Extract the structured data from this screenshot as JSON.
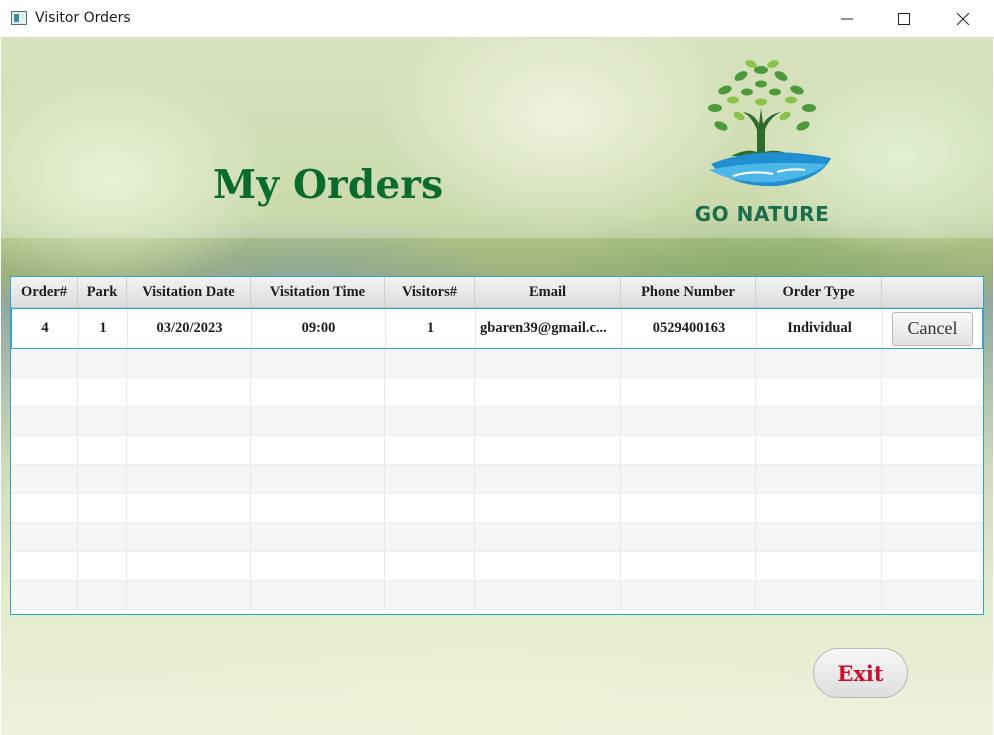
{
  "window": {
    "title": "Visitor Orders"
  },
  "page": {
    "title": "My Orders"
  },
  "logo": {
    "text": "GO NATURE"
  },
  "table": {
    "columns": [
      "Order#",
      "Park",
      "Visitation Date",
      "Visitation Time",
      "Visitors#",
      "Email",
      "Phone Number",
      "Order Type",
      ""
    ],
    "rows": [
      {
        "order": "4",
        "park": "1",
        "date": "03/20/2023",
        "time": "09:00",
        "visitors": "1",
        "email": "gbaren39@gmail.c...",
        "phone": "0529400163",
        "type": "Individual",
        "action": "Cancel"
      }
    ]
  },
  "exit_label": "Exit",
  "colors": {
    "title": "#0b6a2e",
    "exit": "#c8102e",
    "table_border": "#2fa6d0"
  }
}
